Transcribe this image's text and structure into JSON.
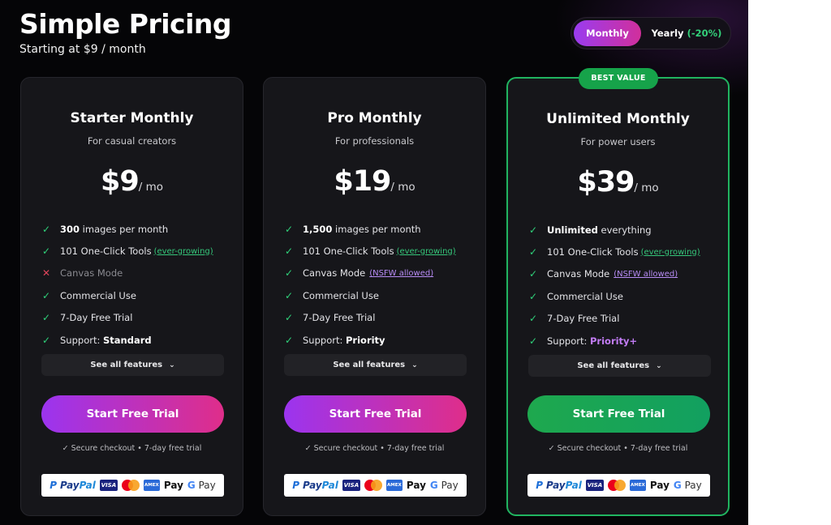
{
  "header": {
    "title": "Simple Pricing",
    "subtitle": "Starting at $9 / month"
  },
  "billing_toggle": {
    "monthly_label": "Monthly",
    "yearly_label": "Yearly",
    "yearly_discount": "(-20%)",
    "selected": "Monthly"
  },
  "badge": "BEST VALUE",
  "plans": [
    {
      "name": "Starter Monthly",
      "description": "For casual creators",
      "price": "$9",
      "period": "/ mo",
      "features": {
        "images_bold": "300",
        "images_text": "images per month",
        "tools_text": "101 One-Click Tools",
        "tools_link": "(ever-growing)",
        "canvas_text": "Canvas Mode",
        "commercial": "Commercial Use",
        "trial": "7-Day Free Trial",
        "support_label": "Support:",
        "support_level": "Standard"
      },
      "see_all": "See all features",
      "cta": "Start Free Trial",
      "secure_note": "✓ Secure checkout • 7-day free trial"
    },
    {
      "name": "Pro Monthly",
      "description": "For professionals",
      "price": "$19",
      "period": "/ mo",
      "features": {
        "images_bold": "1,500",
        "images_text": "images per month",
        "tools_text": "101 One-Click Tools",
        "tools_link": "(ever-growing)",
        "canvas_text": "Canvas Mode",
        "canvas_link": "(NSFW allowed)",
        "commercial": "Commercial Use",
        "trial": "7-Day Free Trial",
        "support_label": "Support:",
        "support_level": "Priority"
      },
      "see_all": "See all features",
      "cta": "Start Free Trial",
      "secure_note": "✓ Secure checkout • 7-day free trial"
    },
    {
      "name": "Unlimited Monthly",
      "description": "For power users",
      "price": "$39",
      "period": "/ mo",
      "features": {
        "images_bold": "Unlimited",
        "images_text": "everything",
        "tools_text": "101 One-Click Tools",
        "tools_link": "(ever-growing)",
        "canvas_text": "Canvas Mode",
        "canvas_link": "(NSFW allowed)",
        "commercial": "Commercial Use",
        "trial": "7-Day Free Trial",
        "support_label": "Support:",
        "support_level": "Priority+"
      },
      "see_all": "See all features",
      "cta": "Start Free Trial",
      "secure_note": "✓ Secure checkout • 7-day free trial"
    }
  ],
  "payment_methods": {
    "paypal_a": "Pay",
    "paypal_b": "Pal",
    "visa": "VISA",
    "amex": "AMEX",
    "apple_pay": "Pay",
    "google_pay_g": "G",
    "google_pay": "Pay"
  },
  "colors": {
    "accent_gradient_start": "#9b34ef",
    "accent_gradient_end": "#df2e8a",
    "best_value_green": "#16a34a",
    "check_green": "#2fd17a",
    "cross_red": "#e0455b",
    "nsfw_link_purple": "#b78cf5"
  },
  "icons": {
    "check": "check-icon",
    "cross": "cross-icon",
    "chevron": "chevron-down-icon"
  }
}
